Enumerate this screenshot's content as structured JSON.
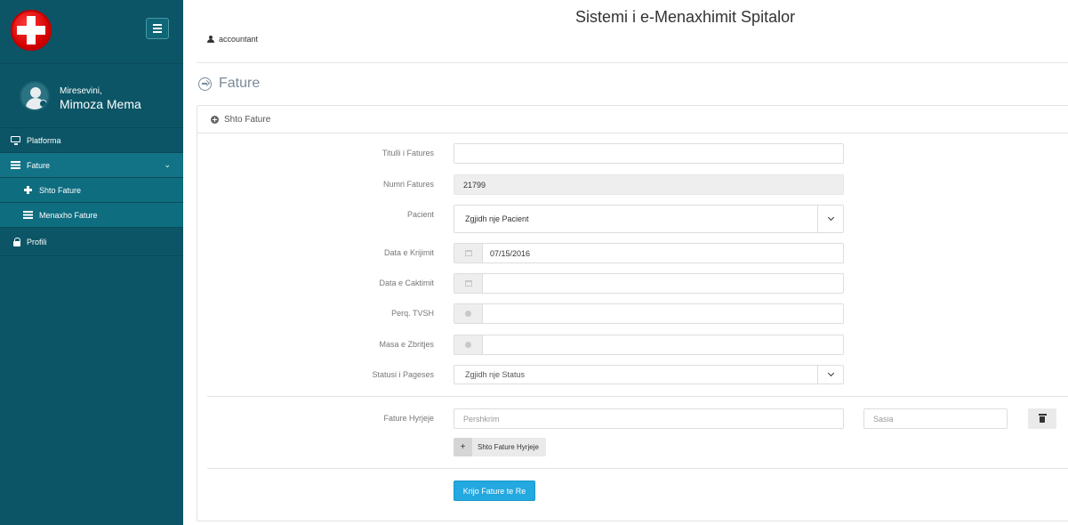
{
  "app": {
    "title": "Sistemi i e-Menaxhimit Spitalor",
    "current_user": "accountant"
  },
  "sidebar": {
    "greeting": "Miresevini,",
    "user_name": "Mimoza Mema",
    "items": [
      {
        "label": "Platforma",
        "icon": "desktop-icon"
      },
      {
        "label": "Fature",
        "icon": "list-icon",
        "caret": "⌄"
      },
      {
        "label": "Shto Fature",
        "icon": "plus-icon"
      },
      {
        "label": "Menaxho Fature",
        "icon": "list-icon"
      },
      {
        "label": "Profili",
        "icon": "lock-icon"
      }
    ]
  },
  "page": {
    "title": "Fature",
    "panel_title": "Shto Fature"
  },
  "form": {
    "labels": {
      "title": "Titulli i Fatures",
      "number": "Numri Fatures",
      "patient": "Pacient",
      "created": "Data e Krijimit",
      "due": "Data e Caktimit",
      "vat": "Perq. TVSH",
      "discount": "Masa e Zbritjes",
      "status": "Statusi i Pageses",
      "entries": "Fature Hyrjeje"
    },
    "values": {
      "title": "",
      "number": "21799",
      "patient": "Zgjidh nje Pacient",
      "created": "07/15/2016",
      "due": "",
      "vat": "",
      "discount": "",
      "status": "Zgjidh nje Status"
    },
    "entry": {
      "description_placeholder": "Pershkrim",
      "quantity_placeholder": "Sasia"
    },
    "add_entry_label": "Shto Fature Hyrjeje",
    "add_entry_plus": "+",
    "submit_label": "Krijo Fature te Re"
  },
  "colors": {
    "sidebar_bg": "#0b5566",
    "sidebar_active": "#137386",
    "primary_button": "#23a8e0"
  }
}
